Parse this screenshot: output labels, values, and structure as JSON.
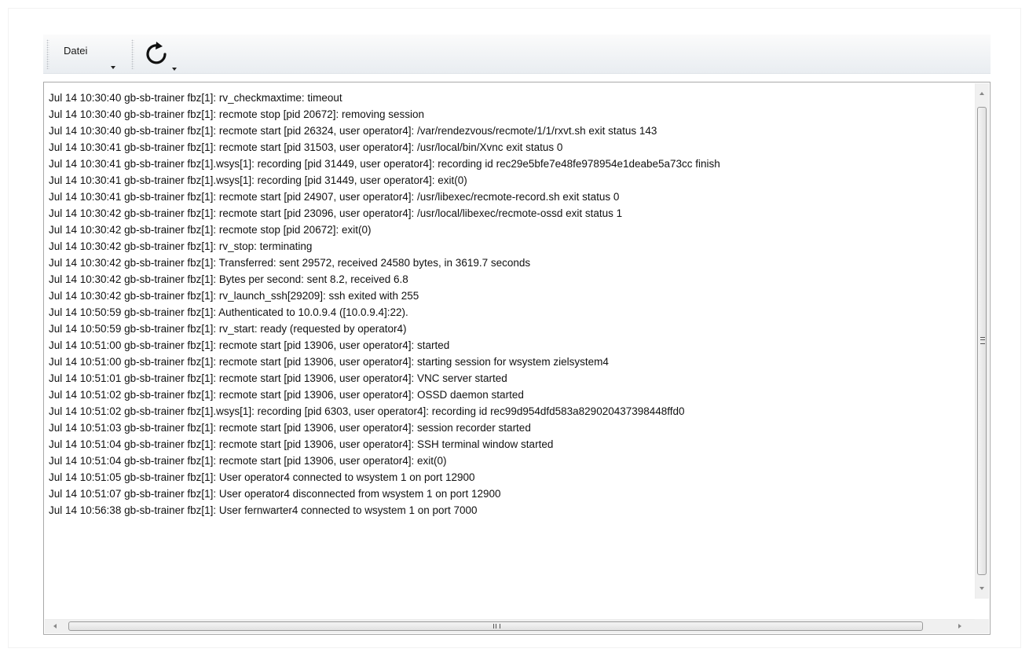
{
  "toolbar": {
    "datei_label": "Datei",
    "refresh_icon": "refresh-icon"
  },
  "log": {
    "lines": [
      "Jul 14 10:30:40 gb-sb-trainer fbz[1]: rv_checkmaxtime: timeout",
      "Jul 14 10:30:40 gb-sb-trainer fbz[1]: recmote stop [pid 20672]: removing session",
      "Jul 14 10:30:40 gb-sb-trainer fbz[1]: recmote start [pid 26324, user operator4]: /var/rendezvous/recmote/1/1/rxvt.sh exit status 143",
      "Jul 14 10:30:41 gb-sb-trainer fbz[1]: recmote start [pid 31503, user operator4]: /usr/local/bin/Xvnc exit status 0",
      "Jul 14 10:30:41 gb-sb-trainer fbz[1].wsys[1]: recording [pid 31449, user operator4]: recording id rec29e5bfe7e48fe978954e1deabe5a73cc finish",
      "Jul 14 10:30:41 gb-sb-trainer fbz[1].wsys[1]: recording [pid 31449, user operator4]: exit(0)",
      "Jul 14 10:30:41 gb-sb-trainer fbz[1]: recmote start [pid 24907, user operator4]: /usr/libexec/recmote-record.sh exit status 0",
      "Jul 14 10:30:42 gb-sb-trainer fbz[1]: recmote start [pid 23096, user operator4]: /usr/local/libexec/recmote-ossd exit status 1",
      "Jul 14 10:30:42 gb-sb-trainer fbz[1]: recmote stop [pid 20672]: exit(0)",
      "Jul 14 10:30:42 gb-sb-trainer fbz[1]: rv_stop: terminating",
      "Jul 14 10:30:42 gb-sb-trainer fbz[1]: Transferred: sent 29572, received 24580 bytes, in 3619.7 seconds",
      "Jul 14 10:30:42 gb-sb-trainer fbz[1]: Bytes per second: sent 8.2, received 6.8",
      "Jul 14 10:30:42 gb-sb-trainer fbz[1]: rv_launch_ssh[29209]: ssh exited with 255",
      "Jul 14 10:50:59 gb-sb-trainer fbz[1]: Authenticated to 10.0.9.4 ([10.0.9.4]:22).",
      "Jul 14 10:50:59 gb-sb-trainer fbz[1]: rv_start: ready (requested by operator4)",
      "Jul 14 10:51:00 gb-sb-trainer fbz[1]: recmote start [pid 13906, user operator4]: started",
      "Jul 14 10:51:00 gb-sb-trainer fbz[1]: recmote start [pid 13906, user operator4]: starting session for wsystem zielsystem4",
      "Jul 14 10:51:01 gb-sb-trainer fbz[1]: recmote start [pid 13906, user operator4]: VNC server started",
      "Jul 14 10:51:02 gb-sb-trainer fbz[1]: recmote start [pid 13906, user operator4]: OSSD daemon started",
      "Jul 14 10:51:02 gb-sb-trainer fbz[1].wsys[1]: recording [pid 6303, user operator4]: recording id rec99d954dfd583a829020437398448ffd0",
      "Jul 14 10:51:03 gb-sb-trainer fbz[1]: recmote start [pid 13906, user operator4]: session recorder started",
      "Jul 14 10:51:04 gb-sb-trainer fbz[1]: recmote start [pid 13906, user operator4]: SSH terminal window started",
      "Jul 14 10:51:04 gb-sb-trainer fbz[1]: recmote start [pid 13906, user operator4]: exit(0)",
      "Jul 14 10:51:05 gb-sb-trainer fbz[1]: User operator4 connected to wsystem 1 on port 12900",
      "Jul 14 10:51:07 gb-sb-trainer fbz[1]: User operator4 disconnected from wsystem 1 on port 12900",
      "Jul 14 10:56:38 gb-sb-trainer fbz[1]: User fernwarter4 connected to wsystem 1 on port 7000"
    ]
  },
  "colors": {
    "text": "#111111",
    "border": "#a9a9a9",
    "toolbar_top": "#fbfbfb",
    "toolbar_bottom": "#e9edf1"
  }
}
